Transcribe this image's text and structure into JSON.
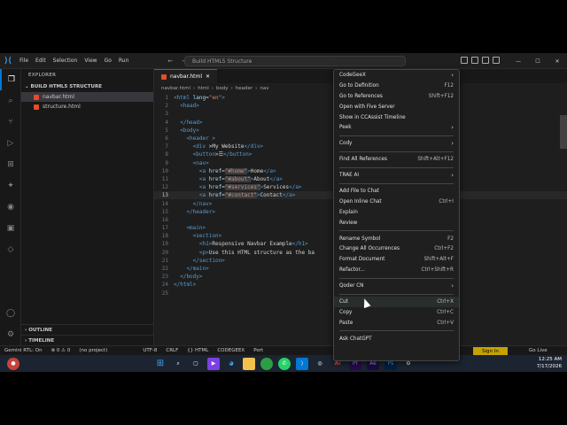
{
  "titlebar": {
    "menus": [
      "File",
      "Edit",
      "Selection",
      "View",
      "Go",
      "Run"
    ],
    "search": "Build HTML5 Structure"
  },
  "sidebar": {
    "title": "EXPLORER",
    "folder": "BUILD HTML5 STRUCTURE",
    "files": [
      "navbar.html",
      "structure.html"
    ],
    "outline": "OUTLINE",
    "timeline": "TIMELINE"
  },
  "editor": {
    "tab": "navbar.html",
    "breadcrumbs": [
      "navbar.html",
      "html",
      "body",
      "header",
      "nav"
    ],
    "lines": [
      {
        "n": "1",
        "parts": [
          [
            "tag",
            "<html"
          ],
          [
            "attr",
            " lang"
          ],
          [
            "txt",
            "="
          ],
          [
            "str",
            "\"en\""
          ],
          [
            "tag",
            ">"
          ]
        ]
      },
      {
        "n": "2",
        "parts": [
          [
            "tag",
            "  <head>"
          ]
        ]
      },
      {
        "n": "3",
        "parts": [
          [
            "txt",
            "  "
          ]
        ]
      },
      {
        "n": "4",
        "parts": [
          [
            "tag",
            "  </head>"
          ]
        ]
      },
      {
        "n": "5",
        "parts": [
          [
            "tag",
            "  <body>"
          ]
        ]
      },
      {
        "n": "6",
        "parts": [
          [
            "tag",
            "    <header >"
          ]
        ]
      },
      {
        "n": "7",
        "parts": [
          [
            "tag",
            "      <div "
          ],
          [
            "txt",
            ">My Website"
          ],
          [
            "tag",
            "</div>"
          ]
        ]
      },
      {
        "n": "8",
        "parts": [
          [
            "tag",
            "      <button"
          ],
          [
            "txt",
            ">☰"
          ],
          [
            "tag",
            "</button>"
          ]
        ]
      },
      {
        "n": "9",
        "parts": [
          [
            "tag",
            "      <nav>"
          ]
        ]
      },
      {
        "n": "10",
        "parts": [
          [
            "tag",
            "        <a"
          ],
          [
            "attr",
            " href"
          ],
          [
            "txt",
            "="
          ],
          [
            "hl",
            "\"#home\""
          ],
          [
            "tag",
            ">"
          ],
          [
            "txt",
            "Home"
          ],
          [
            "tag",
            "</a>"
          ]
        ]
      },
      {
        "n": "11",
        "parts": [
          [
            "tag",
            "        <a"
          ],
          [
            "attr",
            " href"
          ],
          [
            "txt",
            "="
          ],
          [
            "hl",
            "\"#about\""
          ],
          [
            "tag",
            ">"
          ],
          [
            "txt",
            "About"
          ],
          [
            "tag",
            "</a>"
          ]
        ]
      },
      {
        "n": "12",
        "parts": [
          [
            "tag",
            "        <a"
          ],
          [
            "attr",
            " href"
          ],
          [
            "txt",
            "="
          ],
          [
            "hl",
            "\"#services\""
          ],
          [
            "tag",
            ">"
          ],
          [
            "txt",
            "Services"
          ],
          [
            "tag",
            "</a>"
          ]
        ]
      },
      {
        "n": "13",
        "parts": [
          [
            "tag",
            "        <a"
          ],
          [
            "attr",
            " href"
          ],
          [
            "txt",
            "="
          ],
          [
            "hl",
            "\"#contact\""
          ],
          [
            "tag",
            ">"
          ],
          [
            "txt",
            "Contact"
          ],
          [
            "tag",
            "</a>"
          ]
        ]
      },
      {
        "n": "14",
        "parts": [
          [
            "tag",
            "      </nav>"
          ]
        ]
      },
      {
        "n": "15",
        "parts": [
          [
            "tag",
            "    </header>"
          ]
        ]
      },
      {
        "n": "16",
        "parts": [
          [
            "txt",
            ""
          ]
        ]
      },
      {
        "n": "17",
        "parts": [
          [
            "tag",
            "    <main>"
          ]
        ]
      },
      {
        "n": "18",
        "parts": [
          [
            "tag",
            "      <section>"
          ]
        ]
      },
      {
        "n": "19",
        "parts": [
          [
            "tag",
            "        <h1>"
          ],
          [
            "txt",
            "Responsive Navbar Example"
          ],
          [
            "tag",
            "</h1>"
          ]
        ]
      },
      {
        "n": "20",
        "parts": [
          [
            "tag",
            "        <p>"
          ],
          [
            "txt",
            "Use this HTML structure as the ba"
          ]
        ]
      },
      {
        "n": "21",
        "parts": [
          [
            "tag",
            "      </section>"
          ]
        ]
      },
      {
        "n": "22",
        "parts": [
          [
            "tag",
            "    </main>"
          ]
        ]
      },
      {
        "n": "23",
        "parts": [
          [
            "tag",
            "  </body>"
          ]
        ]
      },
      {
        "n": "24",
        "parts": [
          [
            "tag",
            "</html>"
          ]
        ]
      },
      {
        "n": "25",
        "parts": [
          [
            "txt",
            ""
          ]
        ]
      }
    ],
    "current_line": "13"
  },
  "context_menu": {
    "items": [
      {
        "label": "CodeGeeX",
        "shortcut": "",
        "submenu": true
      },
      {
        "label": "Go to Definition",
        "shortcut": "F12"
      },
      {
        "label": "Go to References",
        "shortcut": "Shift+F12"
      },
      {
        "label": "Open with Five Server",
        "shortcut": ""
      },
      {
        "label": "Show in CCAssist Timeline",
        "shortcut": ""
      },
      {
        "label": "Peek",
        "shortcut": "",
        "submenu": true
      },
      {
        "sep": true
      },
      {
        "label": "Cody",
        "shortcut": "",
        "submenu": true
      },
      {
        "sep": true
      },
      {
        "label": "Find All References",
        "shortcut": "Shift+Alt+F12"
      },
      {
        "sep": true
      },
      {
        "label": "TRAE AI",
        "shortcut": "",
        "submenu": true
      },
      {
        "sep": true
      },
      {
        "label": "Add File to Chat",
        "shortcut": ""
      },
      {
        "label": "Open Inline Chat",
        "shortcut": "Ctrl+I"
      },
      {
        "label": "Explain",
        "shortcut": ""
      },
      {
        "label": "Review",
        "shortcut": ""
      },
      {
        "sep": true
      },
      {
        "label": "Rename Symbol",
        "shortcut": "F2"
      },
      {
        "label": "Change All Occurrences",
        "shortcut": "Ctrl+F2"
      },
      {
        "label": "Format Document",
        "shortcut": "Shift+Alt+F"
      },
      {
        "label": "Refactor...",
        "shortcut": "Ctrl+Shift+R"
      },
      {
        "sep": true
      },
      {
        "label": "Qoder CN",
        "shortcut": "",
        "submenu": true
      },
      {
        "sep": true
      },
      {
        "label": "Cut",
        "shortcut": "Ctrl+X",
        "hover": true
      },
      {
        "label": "Copy",
        "shortcut": "Ctrl+C"
      },
      {
        "label": "Paste",
        "shortcut": "Ctrl+V"
      },
      {
        "sep": true
      },
      {
        "label": "Ask ChatGPT",
        "shortcut": ""
      }
    ]
  },
  "status": {
    "left": [
      "Gemini RTL: On",
      "⊗ 0 ⚠ 0",
      "(no project)"
    ],
    "mid": [
      "UTF-8",
      "CRLF",
      "{} HTML",
      "CODEGEEX",
      "Port"
    ],
    "signin": "Sign In",
    "golive": "Go Live"
  },
  "taskbar": {
    "time": "12:25 AM",
    "date": "7/17/2026"
  },
  "colors": {
    "accent": "#0078d4",
    "signin": "#c6a200",
    "tag": "#569cd6",
    "attr": "#9cdcfe",
    "string": "#ce9178"
  }
}
